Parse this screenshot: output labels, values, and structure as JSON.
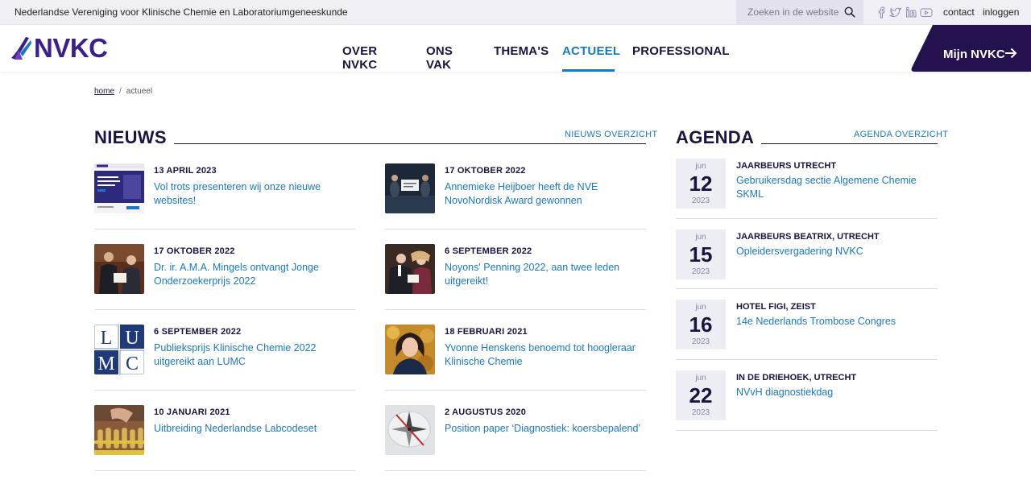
{
  "topbar": {
    "org_name": "Nederlandse Vereniging voor Klinische Chemie en Laboratoriumgeneeskunde",
    "search_placeholder": "Zoeken in de website",
    "social": [
      "facebook-icon",
      "twitter-icon",
      "linkedin-icon",
      "youtube-icon"
    ],
    "contact_label": "contact",
    "login_label": "inloggen"
  },
  "header": {
    "logo_text": "NVKC",
    "nav": [
      {
        "label": "OVER NVKC",
        "active": false
      },
      {
        "label": "ONS VAK",
        "active": false
      },
      {
        "label": "THEMA'S",
        "active": false
      },
      {
        "label": "ACTUEEL",
        "active": true
      },
      {
        "label": "PROFESSIONAL",
        "active": false
      }
    ],
    "mijn_label": "Mijn NVKC"
  },
  "breadcrumb": {
    "home": "home",
    "separator": "/",
    "current": "actueel"
  },
  "news": {
    "title": "NIEUWS",
    "overview_link": "NIEUWS OVERZICHT",
    "items": [
      {
        "date": "13 APRIL 2023",
        "title": "Vol trots presenteren wij onze nieuwe websites!"
      },
      {
        "date": "17 OKTOBER 2022",
        "title": "Annemieke Heijboer heeft de NVE NovoNordisk Award gewonnen"
      },
      {
        "date": "17 OKTOBER 2022",
        "title": "Dr. ir. A.M.A. Mingels ontvangt Jonge Onderzoekerprijs 2022"
      },
      {
        "date": "6 SEPTEMBER 2022",
        "title": "Noyons' Penning 2022, aan twee leden uitgereikt!"
      },
      {
        "date": "6 SEPTEMBER 2022",
        "title": "Publieksprijs Klinische Chemie 2022 uitgereikt aan LUMC"
      },
      {
        "date": "18 FEBRUARI 2021",
        "title": "Yvonne Henskens benoemd tot hoogleraar Klinische Chemie"
      },
      {
        "date": "10 JANUARI 2021",
        "title": "Uitbreiding Nederlandse Labcodeset"
      },
      {
        "date": "2 AUGUSTUS 2020",
        "title": "Position paper ‘Diagnostiek: koersbepalend’"
      }
    ]
  },
  "lumc_letters": [
    "L",
    "U",
    "M",
    "C"
  ],
  "agenda": {
    "title": "AGENDA",
    "overview_link": "AGENDA OVERZICHT",
    "items": [
      {
        "month": "jun",
        "day": "12",
        "year": "2023",
        "location": "JAARBEURS UTRECHT",
        "title": "Gebruikersdag sectie Algemene Chemie SKML"
      },
      {
        "month": "jun",
        "day": "15",
        "year": "2023",
        "location": "JAARBEURS BEATRIX, UTRECHT",
        "title": "Opleidersvergadering NVKC"
      },
      {
        "month": "jun",
        "day": "16",
        "year": "2023",
        "location": "HOTEL FIGI, ZEIST",
        "title": "14e Nederlands Trombose Congres"
      },
      {
        "month": "jun",
        "day": "22",
        "year": "2023",
        "location": "IN DE DRIEHOEK, UTRECHT",
        "title": "NVvH diagnostiekdag"
      }
    ]
  },
  "colors": {
    "brand_dark": "#1b1340",
    "brand_purple": "#3b1f8a",
    "link_blue": "#1a78c2",
    "mijn_bg": "#24124f"
  }
}
